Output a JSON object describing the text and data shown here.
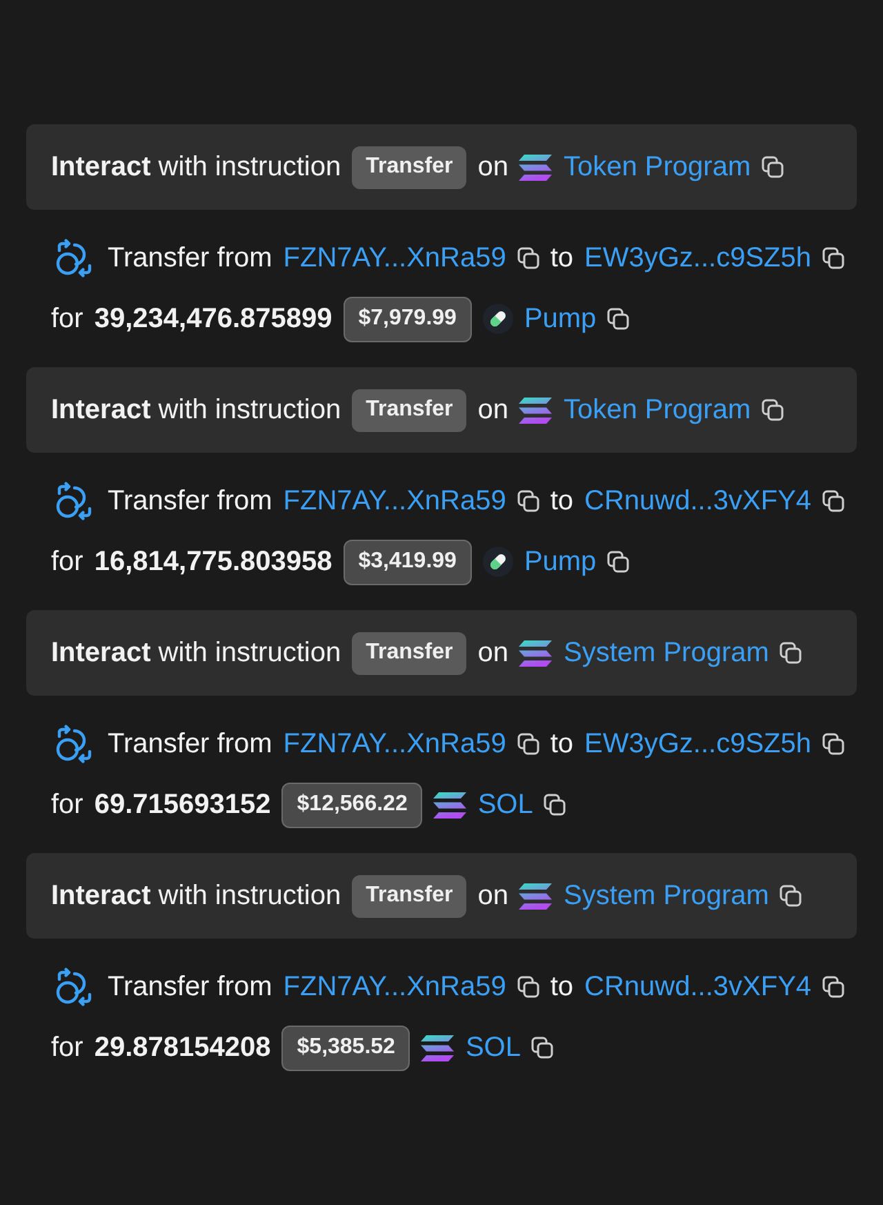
{
  "instructions": [
    {
      "title": "**Interact** with instruction",
      "instruction": "Transfer",
      "on": "on",
      "program": {
        "kind": "stripes",
        "name": "Token Program"
      },
      "transfer": {
        "label": "Transfer from",
        "from": "FZN7AY...XnRa59",
        "to_word": "to",
        "to": "EW3yGz...c9SZ5h",
        "for_word": "for",
        "amount": "39,234,476.875899",
        "usd": "$7,979.99",
        "token": {
          "kind": "pill",
          "name": "Pump"
        }
      }
    },
    {
      "title": "**Interact** with instruction",
      "instruction": "Transfer",
      "on": "on",
      "program": {
        "kind": "stripes",
        "name": "Token Program"
      },
      "transfer": {
        "label": "Transfer from",
        "from": "FZN7AY...XnRa59",
        "to_word": "to",
        "to": "CRnuwd...3vXFY4",
        "for_word": "for",
        "amount": "16,814,775.803958",
        "usd": "$3,419.99",
        "token": {
          "kind": "pill",
          "name": "Pump"
        }
      }
    },
    {
      "title": "**Interact** with instruction",
      "instruction": "Transfer",
      "on": "on",
      "program": {
        "kind": "stripes",
        "name": "System Program"
      },
      "transfer": {
        "label": "Transfer from",
        "from": "FZN7AY...XnRa59",
        "to_word": "to",
        "to": "EW3yGz...c9SZ5h",
        "for_word": "for",
        "amount": "69.715693152",
        "usd": "$12,566.22",
        "token": {
          "kind": "stripes",
          "name": "SOL"
        }
      }
    },
    {
      "title": "**Interact** with instruction",
      "instruction": "Transfer",
      "on": "on",
      "program": {
        "kind": "stripes",
        "name": "System Program"
      },
      "transfer": {
        "label": "Transfer from",
        "from": "FZN7AY...XnRa59",
        "to_word": "to",
        "to": "CRnuwd...3vXFY4",
        "for_word": "for",
        "amount": "29.878154208",
        "usd": "$5,385.52",
        "token": {
          "kind": "stripes",
          "name": "SOL"
        }
      }
    }
  ]
}
